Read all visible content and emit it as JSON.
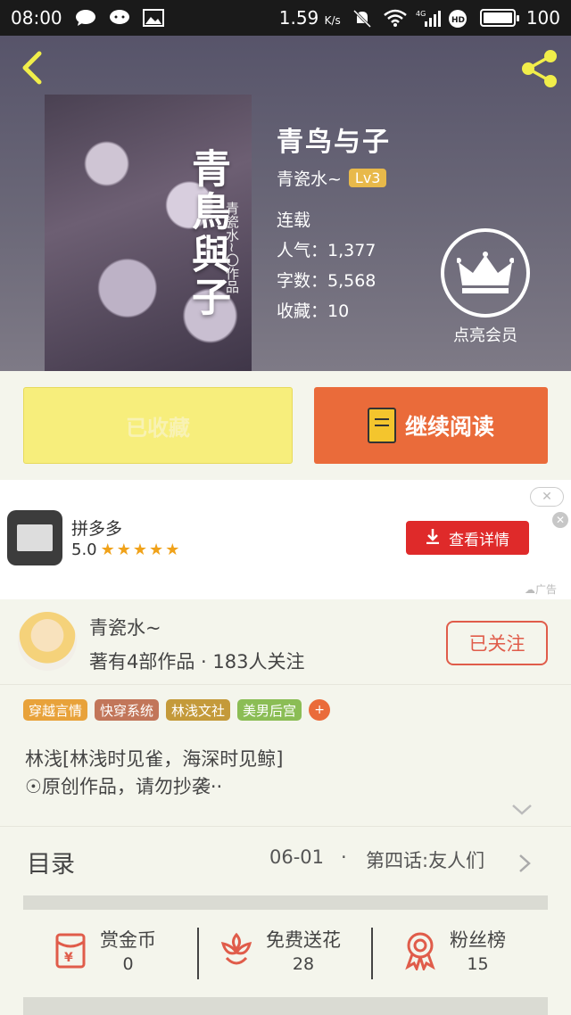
{
  "status_bar": {
    "time": "08:00",
    "speed": "1.59",
    "speed_unit": "K/s",
    "network": "4G",
    "battery": "100"
  },
  "book": {
    "title": "青鸟与子",
    "cover_title": "青鳥與子",
    "cover_author": "青瓷水~〇作品",
    "author": "青瓷水~",
    "level": "Lv3",
    "status": "连载",
    "popularity": "人气：1,377",
    "word_count": "字数：5,568",
    "favorites": "收藏：10"
  },
  "vip": {
    "label": "点亮会员"
  },
  "actions": {
    "favorited_label": "已收藏",
    "continue_label": "继续阅读"
  },
  "ad": {
    "app_name": "拼多多",
    "rating": "5.0",
    "stars": "★★★★★",
    "button_label": "查看详情",
    "ad_tag": "广告"
  },
  "author_section": {
    "name": "青瓷水~",
    "stats": "著有4部作品 · 183人关注",
    "follow_label": "已关注"
  },
  "tags": [
    {
      "label": "穿越言情",
      "color": "#e8a23a"
    },
    {
      "label": "快穿系统",
      "color": "#c2765a"
    },
    {
      "label": "林浅文社",
      "color": "#c49a3a"
    },
    {
      "label": "美男后宫",
      "color": "#8bbd55"
    }
  ],
  "tag_more": "+",
  "description": {
    "line1": "林浅[林浅时见雀，海深时见鲸]",
    "line2": "☉原创作品，请勿抄袭··"
  },
  "catalog": {
    "title": "目录",
    "date": "06-01",
    "sep": "·",
    "chapter": "第四话:友人们"
  },
  "stats": [
    {
      "title": "赏金币",
      "value": "0",
      "icon": "red-envelope-icon"
    },
    {
      "title": "免费送花",
      "value": "28",
      "icon": "flower-icon"
    },
    {
      "title": "粉丝榜",
      "value": "15",
      "icon": "medal-icon"
    }
  ],
  "colors": {
    "accent_orange": "#ea6b3a",
    "fav_yellow": "#f7ee7c",
    "ad_red": "#df2a2a",
    "follow_red": "#e05c4a"
  }
}
